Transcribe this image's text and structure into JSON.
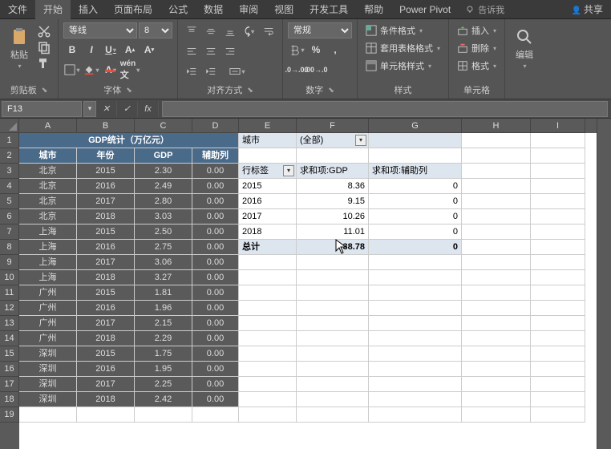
{
  "menu": {
    "file": "文件",
    "home": "开始",
    "insert": "插入",
    "layout": "页面布局",
    "formula": "公式",
    "data": "数据",
    "review": "审阅",
    "view": "视图",
    "dev": "开发工具",
    "help": "帮助",
    "pivot": "Power Pivot",
    "tell": "告诉我",
    "share": "共享"
  },
  "ribbon": {
    "clipboard": {
      "paste": "粘贴",
      "label": "剪贴板"
    },
    "font": {
      "name": "等线",
      "size": "8",
      "label": "字体"
    },
    "align": {
      "label": "对齐方式"
    },
    "number": {
      "format": "常规",
      "label": "数字"
    },
    "styles": {
      "cond": "条件格式",
      "table": "套用表格格式",
      "cell": "单元格样式",
      "label": "样式"
    },
    "cells": {
      "insert": "插入",
      "delete": "删除",
      "format": "格式",
      "label": "单元格"
    },
    "edit": {
      "label": "编辑"
    }
  },
  "namebox": {
    "ref": "F13"
  },
  "columns": [
    "A",
    "B",
    "C",
    "D",
    "E",
    "F",
    "G",
    "H",
    "I"
  ],
  "sheet": {
    "title": "GDP统计（万亿元）",
    "headers": {
      "city": "城市",
      "year": "年份",
      "gdp": "GDP",
      "aux": "辅助列"
    },
    "rows": [
      {
        "city": "北京",
        "year": "2015",
        "gdp": "2.30",
        "aux": "0.00"
      },
      {
        "city": "北京",
        "year": "2016",
        "gdp": "2.49",
        "aux": "0.00"
      },
      {
        "city": "北京",
        "year": "2017",
        "gdp": "2.80",
        "aux": "0.00"
      },
      {
        "city": "北京",
        "year": "2018",
        "gdp": "3.03",
        "aux": "0.00"
      },
      {
        "city": "上海",
        "year": "2015",
        "gdp": "2.50",
        "aux": "0.00"
      },
      {
        "city": "上海",
        "year": "2016",
        "gdp": "2.75",
        "aux": "0.00"
      },
      {
        "city": "上海",
        "year": "2017",
        "gdp": "3.06",
        "aux": "0.00"
      },
      {
        "city": "上海",
        "year": "2018",
        "gdp": "3.27",
        "aux": "0.00"
      },
      {
        "city": "广州",
        "year": "2015",
        "gdp": "1.81",
        "aux": "0.00"
      },
      {
        "city": "广州",
        "year": "2016",
        "gdp": "1.96",
        "aux": "0.00"
      },
      {
        "city": "广州",
        "year": "2017",
        "gdp": "2.15",
        "aux": "0.00"
      },
      {
        "city": "广州",
        "year": "2018",
        "gdp": "2.29",
        "aux": "0.00"
      },
      {
        "city": "深圳",
        "year": "2015",
        "gdp": "1.75",
        "aux": "0.00"
      },
      {
        "city": "深圳",
        "year": "2016",
        "gdp": "1.95",
        "aux": "0.00"
      },
      {
        "city": "深圳",
        "year": "2017",
        "gdp": "2.25",
        "aux": "0.00"
      },
      {
        "city": "深圳",
        "year": "2018",
        "gdp": "2.42",
        "aux": "0.00"
      }
    ]
  },
  "pivot": {
    "filter_field": "城市",
    "filter_val": "(全部)",
    "row_label": "行标签",
    "col_gdp": "求和项:GDP",
    "col_aux": "求和项:辅助列",
    "rows": [
      {
        "y": "2015",
        "g": "8.36",
        "a": "0"
      },
      {
        "y": "2016",
        "g": "9.15",
        "a": "0"
      },
      {
        "y": "2017",
        "g": "10.26",
        "a": "0"
      },
      {
        "y": "2018",
        "g": "11.01",
        "a": "0"
      }
    ],
    "total": "总计",
    "total_g": "38.78",
    "total_a": "0"
  }
}
